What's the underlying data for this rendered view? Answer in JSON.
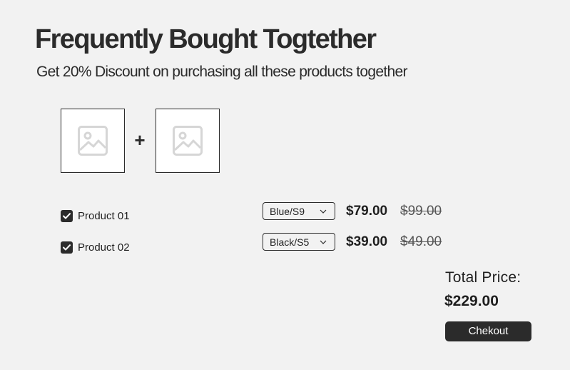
{
  "header": {
    "title": "Frequently Bought Togtether",
    "subtitle": "Get 20% Discount on purchasing all these products together"
  },
  "bundle": {
    "plus_sign": "+",
    "image_icon": "image-placeholder-icon"
  },
  "products": [
    {
      "checked": true,
      "name": "Product 01",
      "variant": "Blue/S9",
      "price": "$79.00",
      "old_price": "$99.00"
    },
    {
      "checked": true,
      "name": "Product 02",
      "variant": "Black/S5",
      "price": "$39.00",
      "old_price": "$49.00"
    }
  ],
  "summary": {
    "total_label": "Total Price:",
    "total_value": "$229.00",
    "checkout_label": "Chekout"
  },
  "colors": {
    "background": "#f2f2f2",
    "dark": "#2b2b2b",
    "placeholder_icon": "#d6d6d6"
  }
}
